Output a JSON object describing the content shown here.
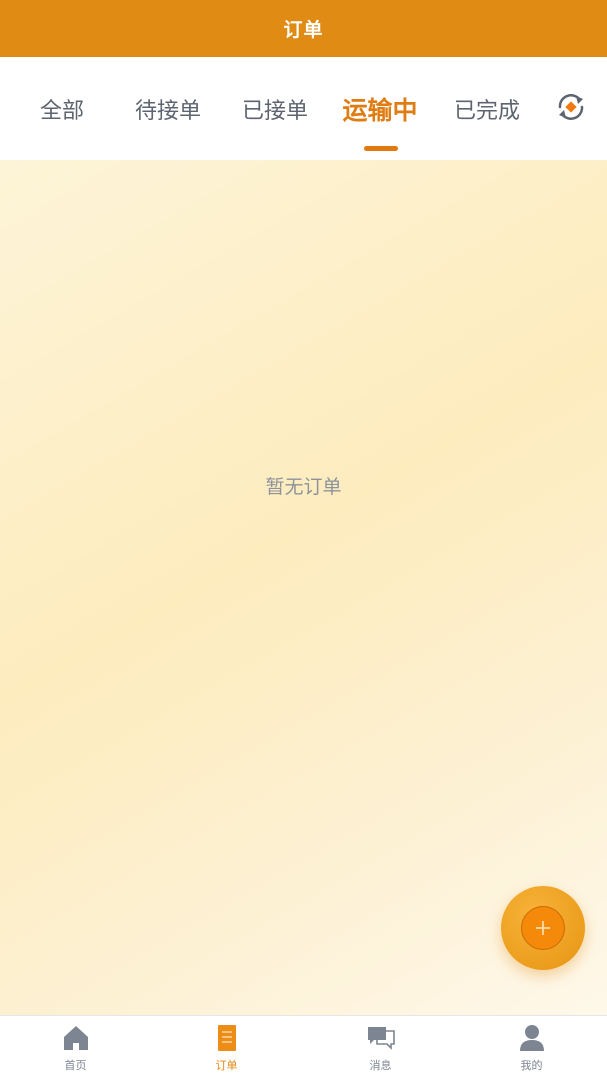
{
  "header": {
    "title": "订单"
  },
  "tabs": [
    {
      "label": "全部"
    },
    {
      "label": "待接单"
    },
    {
      "label": "已接单"
    },
    {
      "label": "运输中",
      "active": true
    },
    {
      "label": "已完成"
    }
  ],
  "refresh": {
    "icon": "refresh-icon"
  },
  "main": {
    "empty_text": "暂无订单"
  },
  "fab": {
    "icon": "plus-icon"
  },
  "bottom_nav": [
    {
      "label": "首页",
      "icon": "home-icon"
    },
    {
      "label": "订单",
      "icon": "order-icon",
      "active": true
    },
    {
      "label": "消息",
      "icon": "message-icon"
    },
    {
      "label": "我的",
      "icon": "user-icon"
    }
  ],
  "colors": {
    "brand": "#e08b14",
    "active_tab": "#df7c12",
    "inactive_tab": "#5d6470",
    "fab": "#ec9d1d",
    "nav_inactive": "#7d8592"
  }
}
